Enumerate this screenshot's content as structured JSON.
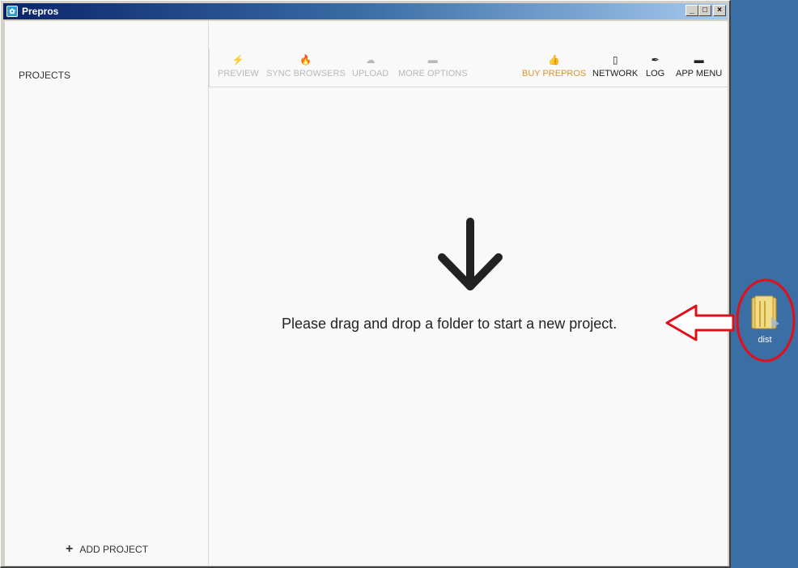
{
  "window": {
    "title": "Prepros",
    "buttons": {
      "minimize": "_",
      "maximize": "□",
      "close": "×"
    }
  },
  "sidebar": {
    "projects_label": "PROJECTS",
    "add_project_label": "ADD PROJECT"
  },
  "toolbar": {
    "items": [
      {
        "label": "PREVIEW",
        "icon": "bolt-icon",
        "enabled": false
      },
      {
        "label": "SYNC BROWSERS",
        "icon": "flame-icon",
        "enabled": false
      },
      {
        "label": "UPLOAD",
        "icon": "cloud-icon",
        "enabled": false
      },
      {
        "label": "MORE OPTIONS",
        "icon": "menu-icon",
        "enabled": false
      },
      {
        "label": "BUY PREPROS",
        "icon": "thumbs-up-icon",
        "enabled": true
      },
      {
        "label": "NETWORK",
        "icon": "mobile-icon",
        "enabled": true
      },
      {
        "label": "LOG",
        "icon": "feather-icon",
        "enabled": true
      },
      {
        "label": "APP MENU",
        "icon": "menu-icon",
        "enabled": true
      }
    ]
  },
  "main": {
    "drop_message": "Please drag and drop a folder to start a new project."
  },
  "desktop": {
    "folder_label": "dist"
  },
  "colors": {
    "accent_buy": "#d9952a",
    "annotation_red": "#e0101a",
    "desktop_bg": "#3b6ea5"
  }
}
